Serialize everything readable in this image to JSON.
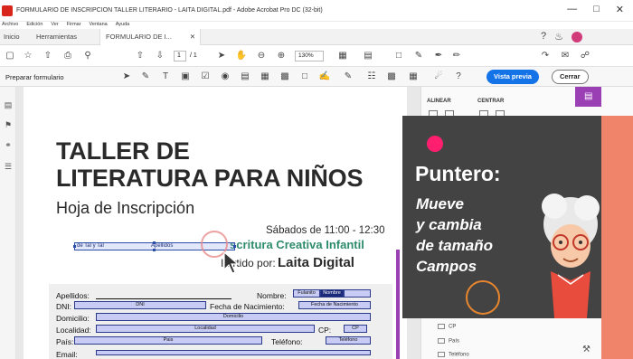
{
  "window": {
    "title": "FORMULARIO DE INSCRIPCION TALLER LITERARIO - LAITA DIGITAL.pdf - Adobe Acrobat Pro DC (32-bit)",
    "controls": [
      "—",
      "□",
      "✕"
    ]
  },
  "menu": [
    "Archivo",
    "Edición",
    "Ver",
    "Firmar",
    "Ventana",
    "Ayuda"
  ],
  "tabs": {
    "home": "Inicio",
    "tools": "Herramientas",
    "document": "FORMULARIO DE I...",
    "close": "✕"
  },
  "toolbar": {
    "page_current": "1",
    "page_total": "/ 1",
    "zoom": "130%"
  },
  "form_toolbar": {
    "label": "Preparar formulario",
    "preview_button": "Vista previa",
    "close_button": "Cerrar"
  },
  "document": {
    "title_line1": "TALLER DE",
    "title_line2": "LITERATURA PARA NIÑOS",
    "subtitle": "Hoja de Inscripción",
    "schedule": "Sábados de 11:00 - 12:30",
    "brand_line": "scritura Creativa Infantil",
    "imparted_prefix": "I   artido por:",
    "imparted_brand": "Laita Digital",
    "selected_field_text": "de Tal y Tal",
    "selected_field_name": "Apellidos",
    "form": {
      "apellidos_label": "Apellidos:",
      "nombre_label": "Nombre:",
      "nombre_hint": "Fulanito",
      "nombre_field": "Nombre",
      "dni_label": "DNI:",
      "dni_field": "DNI",
      "fecha_label": "Fecha de Nacimiento:",
      "fecha_field": "Fecha de Nacimiento",
      "domicilio_label": "Domicilio:",
      "domicilio_field": "Domicilio",
      "localidad_label": "Localidad:",
      "localidad_field": "Localidad",
      "cp_label": "CP:",
      "cp_field": "CP",
      "pais_label": "País:",
      "pais_field": "Pais",
      "telefono_label": "Teléfono:",
      "telefono_field": "Teléfono",
      "email_label": "Email:"
    }
  },
  "right_panel": {
    "align_label": "ALINEAR",
    "center_label": "CENTRAR",
    "field_items": [
      "CP",
      "País",
      "Teléfono"
    ]
  },
  "overlay": {
    "title": "Puntero:",
    "line1": "Mueve",
    "line2": "y cambia",
    "line3": "de tamaño",
    "line4": "Campos"
  },
  "colors": {
    "primary_button": "#1473e6",
    "overlay_bg": "#434343",
    "brand_green": "#2e8b6b",
    "field_fill": "#c8ccf4",
    "accent_pink": "#ff1f6e",
    "accent_orange": "#e8862e",
    "panel_accent": "#9b3fb4"
  }
}
